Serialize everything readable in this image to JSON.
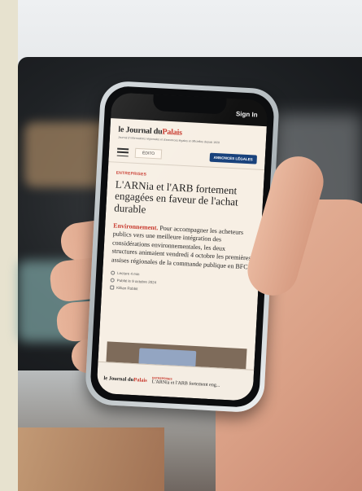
{
  "status": {
    "signin_label": "Sign In"
  },
  "masthead": {
    "logo_part1": "le Journal du",
    "logo_part2": "Palais",
    "tagline": "Journal d'informations régionales et d'annonces légales et officielles depuis 1828"
  },
  "nav": {
    "edito_label": "ÉDITO",
    "annonces_label": "ANNONCES LÉGALES"
  },
  "article": {
    "category": "ENTREPRISES",
    "headline": "L'ARNia et l'ARB fortement engagées en faveur de l'achat durable",
    "lead_highlight": "Environnement.",
    "lead_text": " Pour accompagner les acheteurs publics vers une meilleure intégration des considérations environnementales, les deux structures animaient vendredi 4 octobre les premières assises régionales de la commande publique en BFC.",
    "read_time": "Lecture 4 min",
    "published": "Publié le 9 octobre 2024",
    "author": "Killian Robbit"
  },
  "bottom_bar": {
    "logo_part1": "le Journal du",
    "logo_part2": "Palais",
    "category": "ENTREPRISES",
    "title": "L'ARNia et l'ARB fortement eng..."
  }
}
